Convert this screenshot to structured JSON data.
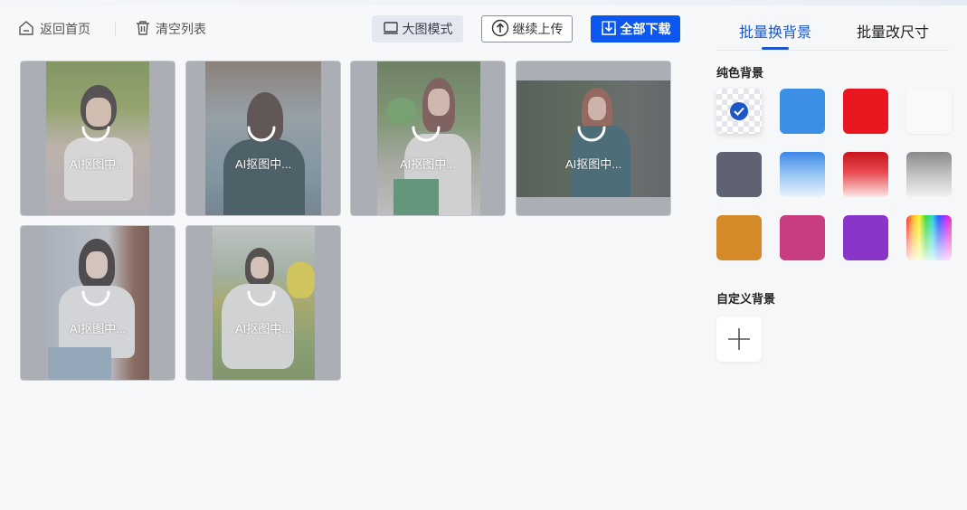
{
  "toolbar": {
    "home_label": "返回首页",
    "clear_label": "清空列表",
    "mode_label": "大图模式",
    "upload_label": "继续上传",
    "download_label": "全部下载"
  },
  "images": [
    {
      "status": "AI抠图中..."
    },
    {
      "status": "AI抠图中..."
    },
    {
      "status": "AI抠图中..."
    },
    {
      "status": "AI抠图中..."
    },
    {
      "status": "AI抠图中..."
    },
    {
      "status": "AI抠图中..."
    }
  ],
  "panel": {
    "tabs": [
      {
        "label": "批量换背景",
        "active": true
      },
      {
        "label": "批量改尺寸",
        "active": false
      }
    ],
    "solid_title": "纯色背景",
    "custom_title": "自定义背景",
    "swatches": [
      {
        "name": "transparent",
        "selected": true
      },
      {
        "name": "blue",
        "color": "#3d8fe6"
      },
      {
        "name": "red",
        "color": "#ea1620"
      },
      {
        "name": "white",
        "color": "#f8f9fa"
      },
      {
        "name": "slate",
        "color": "#5f6273"
      },
      {
        "name": "blue-gradient",
        "color": "#4f96e8"
      },
      {
        "name": "red-gradient",
        "color": "#d8232a"
      },
      {
        "name": "gray-gradient",
        "color": "#a8a8aa"
      },
      {
        "name": "orange",
        "color": "#d48a28"
      },
      {
        "name": "magenta",
        "color": "#c83c80"
      },
      {
        "name": "purple",
        "color": "#8a35c9"
      },
      {
        "name": "rainbow",
        "color": "multicolor"
      }
    ]
  },
  "colors": {
    "accent": "#1d57c6",
    "primary_button": "#0b57f0"
  }
}
